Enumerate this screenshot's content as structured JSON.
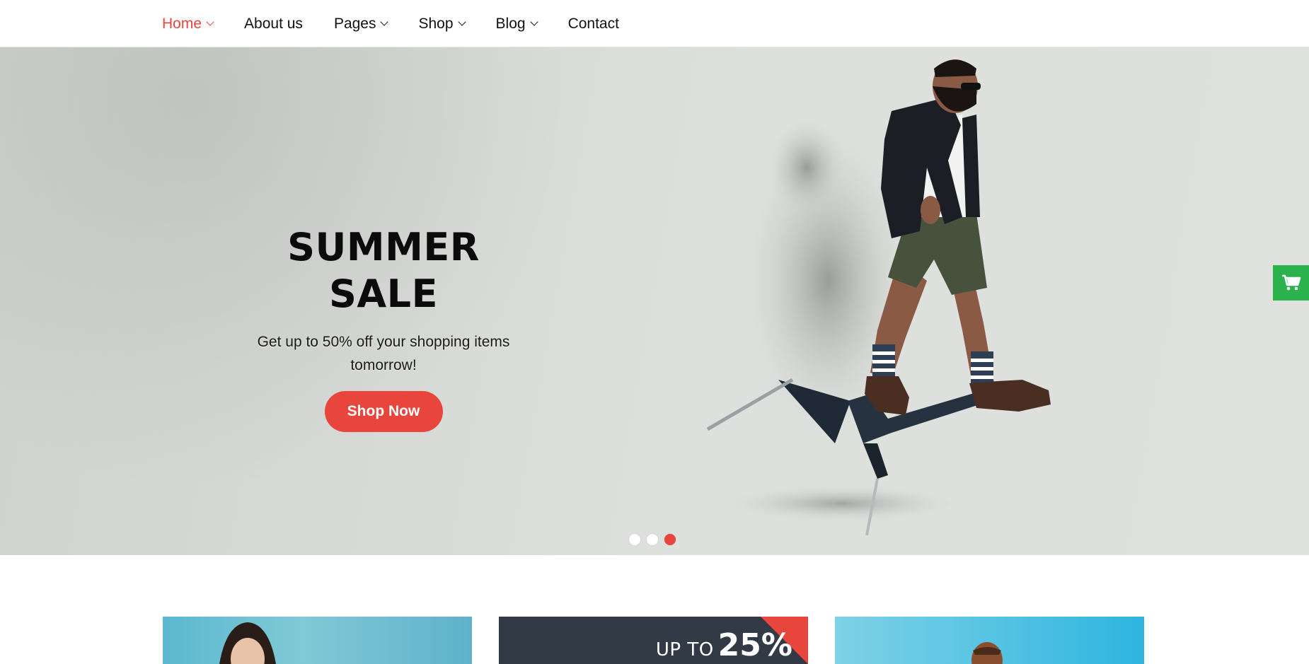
{
  "nav": {
    "items": [
      {
        "label": "Home",
        "has_dropdown": true,
        "active": true
      },
      {
        "label": "About us",
        "has_dropdown": false,
        "active": false
      },
      {
        "label": "Pages",
        "has_dropdown": true,
        "active": false
      },
      {
        "label": "Shop",
        "has_dropdown": true,
        "active": false
      },
      {
        "label": "Blog",
        "has_dropdown": true,
        "active": false
      },
      {
        "label": "Contact",
        "has_dropdown": false,
        "active": false
      }
    ]
  },
  "hero": {
    "title": "SUMMER SALE",
    "subtitle": "Get up to 50% off your shopping items tomorrow!",
    "cta_label": "Shop Now",
    "slides_total": 3,
    "active_slide": 3
  },
  "cart_float": {
    "icon": "shopping-cart-icon"
  },
  "promo_cards": {
    "card2": {
      "up_to": "UP TO",
      "percent": "25%"
    }
  },
  "colors": {
    "accent": "#e8453c",
    "cart_green": "#2bb24c",
    "promo_dark": "#323a45"
  }
}
